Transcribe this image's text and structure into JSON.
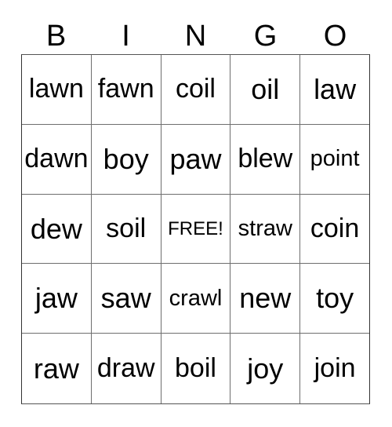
{
  "card": {
    "title": "BINGO",
    "header_letters": [
      "B",
      "I",
      "N",
      "G",
      "O"
    ],
    "free_space_label": "FREE!",
    "colors": {
      "background": "#ffffff",
      "text": "#000000",
      "grid_line": "#6e6e6e",
      "outer_border": "#333333"
    },
    "grid": {
      "rows": 5,
      "columns": 5,
      "cells": [
        [
          {
            "text": "lawn"
          },
          {
            "text": "fawn"
          },
          {
            "text": "coil"
          },
          {
            "text": "oil"
          },
          {
            "text": "law"
          }
        ],
        [
          {
            "text": "dawn"
          },
          {
            "text": "boy"
          },
          {
            "text": "paw"
          },
          {
            "text": "blew"
          },
          {
            "text": "point"
          }
        ],
        [
          {
            "text": "dew"
          },
          {
            "text": "soil"
          },
          {
            "text": "FREE!"
          },
          {
            "text": "straw"
          },
          {
            "text": "coin"
          }
        ],
        [
          {
            "text": "jaw"
          },
          {
            "text": "saw"
          },
          {
            "text": "crawl"
          },
          {
            "text": "new"
          },
          {
            "text": "toy"
          }
        ],
        [
          {
            "text": "raw"
          },
          {
            "text": "draw"
          },
          {
            "text": "boil"
          },
          {
            "text": "joy"
          },
          {
            "text": "join"
          }
        ]
      ]
    }
  }
}
